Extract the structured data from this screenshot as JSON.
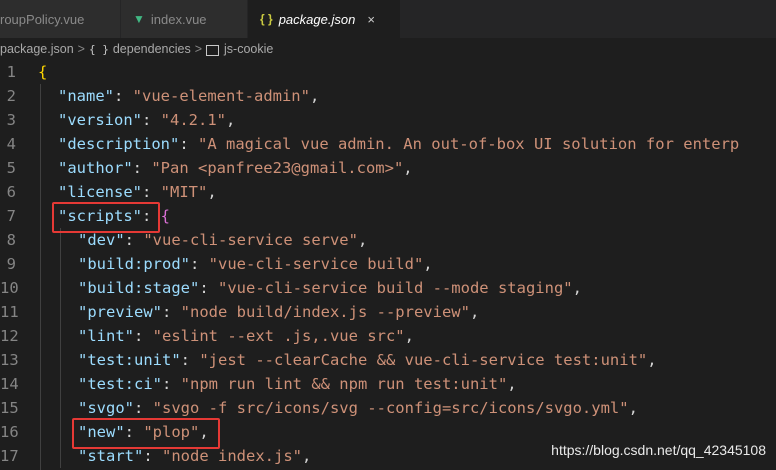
{
  "tabs": [
    {
      "label": "roupPolicy.vue",
      "icon": "vue-icon",
      "active": false
    },
    {
      "label": "index.vue",
      "icon": "vue-icon",
      "active": false
    },
    {
      "label": "package.json",
      "icon": "json-icon",
      "active": true
    }
  ],
  "tab_json_glyph": "{ }",
  "tab_close": "×",
  "breadcrumb": {
    "file": "package.json",
    "sep": ">",
    "braces": "{ }",
    "item1": "dependencies",
    "item2": "js-cookie"
  },
  "lines": [
    {
      "n": "1",
      "t": [
        "{"
      ]
    },
    {
      "n": "2",
      "t": [
        "\"name\"",
        ": ",
        "\"vue-element-admin\"",
        ","
      ]
    },
    {
      "n": "3",
      "t": [
        "\"version\"",
        ": ",
        "\"4.2.1\"",
        ","
      ]
    },
    {
      "n": "4",
      "t": [
        "\"description\"",
        ": ",
        "\"A magical vue admin. An out-of-box UI solution for enterp",
        ""
      ]
    },
    {
      "n": "5",
      "t": [
        "\"author\"",
        ": ",
        "\"Pan <panfree23@gmail.com>\"",
        ","
      ]
    },
    {
      "n": "6",
      "t": [
        "\"license\"",
        ": ",
        "\"MIT\"",
        ","
      ]
    },
    {
      "n": "7",
      "t": [
        "\"scripts\"",
        ": ",
        "{"
      ]
    },
    {
      "n": "8",
      "t": [
        "\"dev\"",
        ": ",
        "\"vue-cli-service serve\"",
        ","
      ]
    },
    {
      "n": "9",
      "t": [
        "\"build:prod\"",
        ": ",
        "\"vue-cli-service build\"",
        ","
      ]
    },
    {
      "n": "10",
      "t": [
        "\"build:stage\"",
        ": ",
        "\"vue-cli-service build --mode staging\"",
        ","
      ]
    },
    {
      "n": "11",
      "t": [
        "\"preview\"",
        ": ",
        "\"node build/index.js --preview\"",
        ","
      ]
    },
    {
      "n": "12",
      "t": [
        "\"lint\"",
        ": ",
        "\"eslint --ext .js,.vue src\"",
        ","
      ]
    },
    {
      "n": "13",
      "t": [
        "\"test:unit\"",
        ": ",
        "\"jest --clearCache && vue-cli-service test:unit\"",
        ","
      ]
    },
    {
      "n": "14",
      "t": [
        "\"test:ci\"",
        ": ",
        "\"npm run lint && npm run test:unit\"",
        ","
      ]
    },
    {
      "n": "15",
      "t": [
        "\"svgo\"",
        ": ",
        "\"svgo -f src/icons/svg --config=src/icons/svgo.yml\"",
        ","
      ]
    },
    {
      "n": "16",
      "t": [
        "\"new\"",
        ": ",
        "\"plop\"",
        ","
      ]
    },
    {
      "n": "17",
      "t": [
        "\"start\"",
        ": ",
        "\"node index.js\"",
        ","
      ]
    }
  ],
  "watermark": "https://blog.csdn.net/qq_42345108",
  "colors": {
    "highlight": "#e53935",
    "key": "#9cdcfe",
    "string": "#ce9178"
  }
}
